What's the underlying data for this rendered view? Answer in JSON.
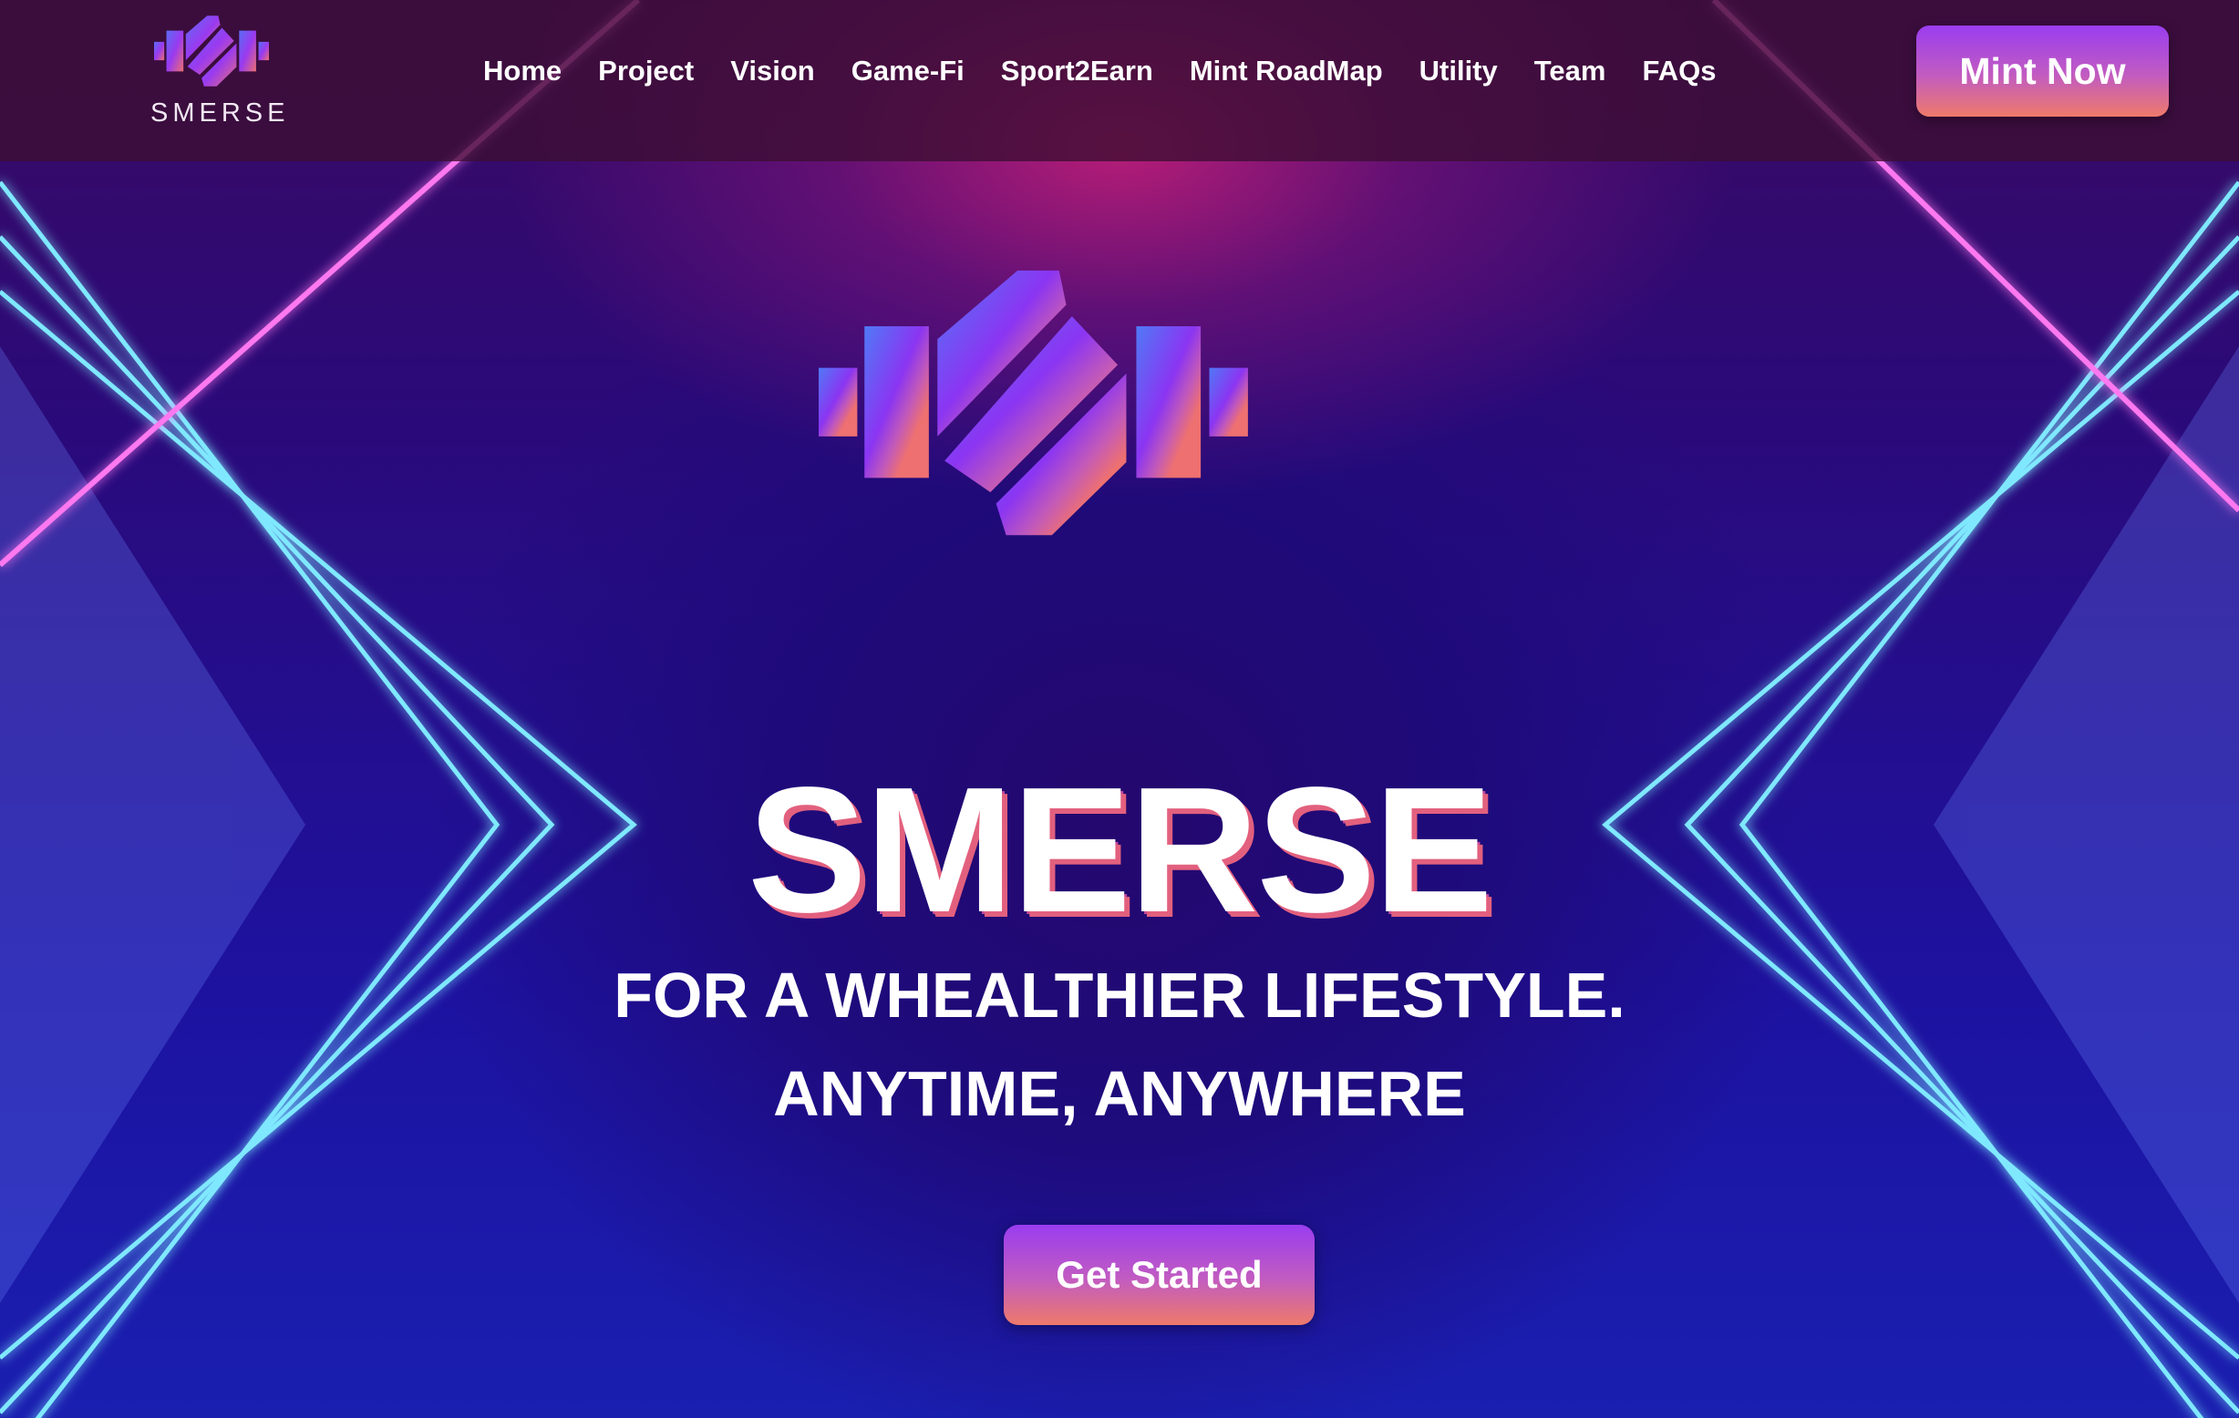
{
  "brand": {
    "name": "SMERSE"
  },
  "nav": {
    "items": [
      {
        "label": "Home"
      },
      {
        "label": "Project"
      },
      {
        "label": "Vision"
      },
      {
        "label": "Game-Fi"
      },
      {
        "label": "Sport2Earn"
      },
      {
        "label": "Mint RoadMap"
      },
      {
        "label": "Utility"
      },
      {
        "label": "Team"
      },
      {
        "label": "FAQs"
      }
    ],
    "cta": "Mint Now"
  },
  "hero": {
    "title": "SMERSE",
    "tagline_line1": "FOR A WHEALTHIER LIFESTYLE.",
    "tagline_line2": "ANYTIME, ANYWHERE",
    "button": "Get Started"
  },
  "colors": {
    "gradient_start": "#6a5cf6",
    "gradient_mid": "#8a3cf0",
    "gradient_end": "#ee7a6a",
    "neon_cyan": "#6fe3ff",
    "neon_magenta": "#ff6bf0"
  }
}
